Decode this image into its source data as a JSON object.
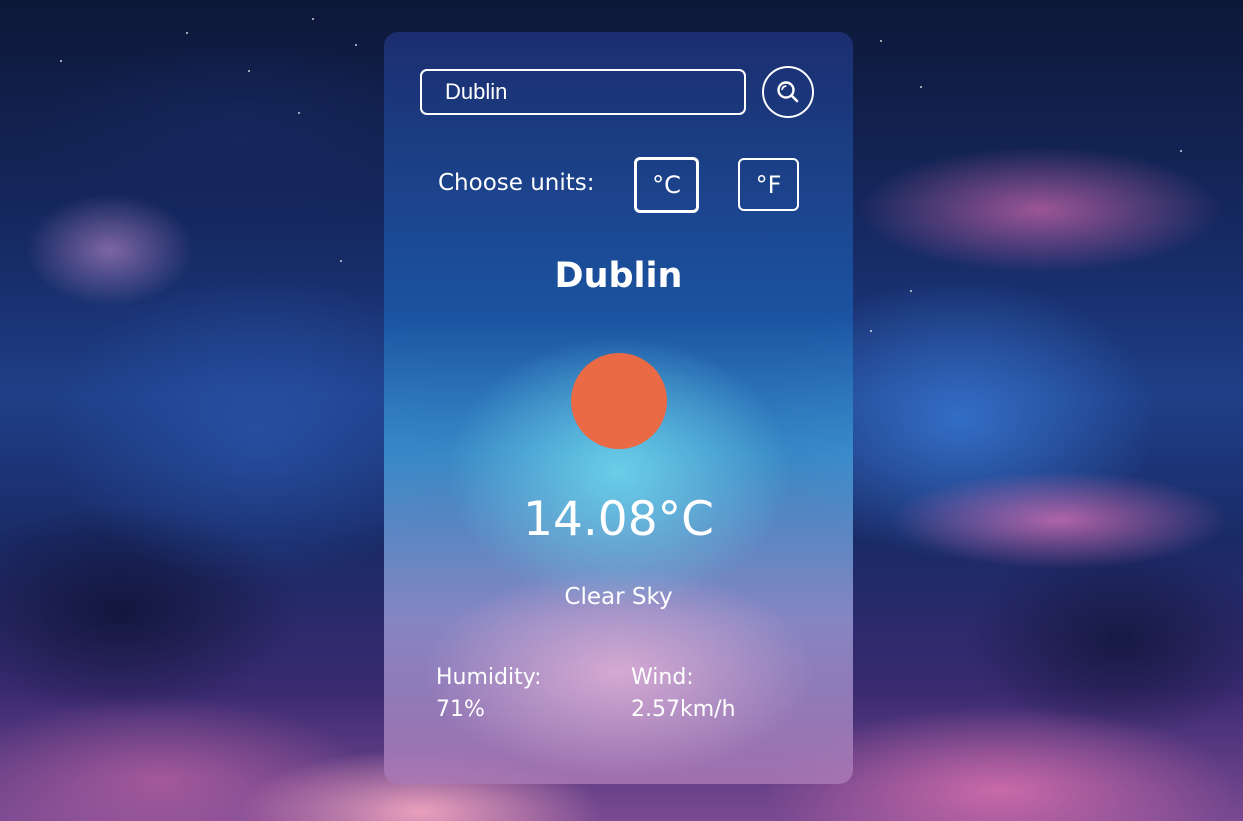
{
  "search": {
    "value": "Dublin",
    "button_icon": "search-icon"
  },
  "units": {
    "label": "Choose units:",
    "celsius_label": "°C",
    "fahrenheit_label": "°F",
    "selected": "°C"
  },
  "weather": {
    "city": "Dublin",
    "icon": "sun-icon",
    "icon_color": "#e96a44",
    "temperature": "14.08°C",
    "description": "Clear Sky",
    "humidity_label": "Humidity:",
    "humidity_value": "71%",
    "wind_label": "Wind:",
    "wind_value": "2.57km/h"
  },
  "colors": {
    "text": "#ffffff",
    "sun": "#e96a44"
  }
}
